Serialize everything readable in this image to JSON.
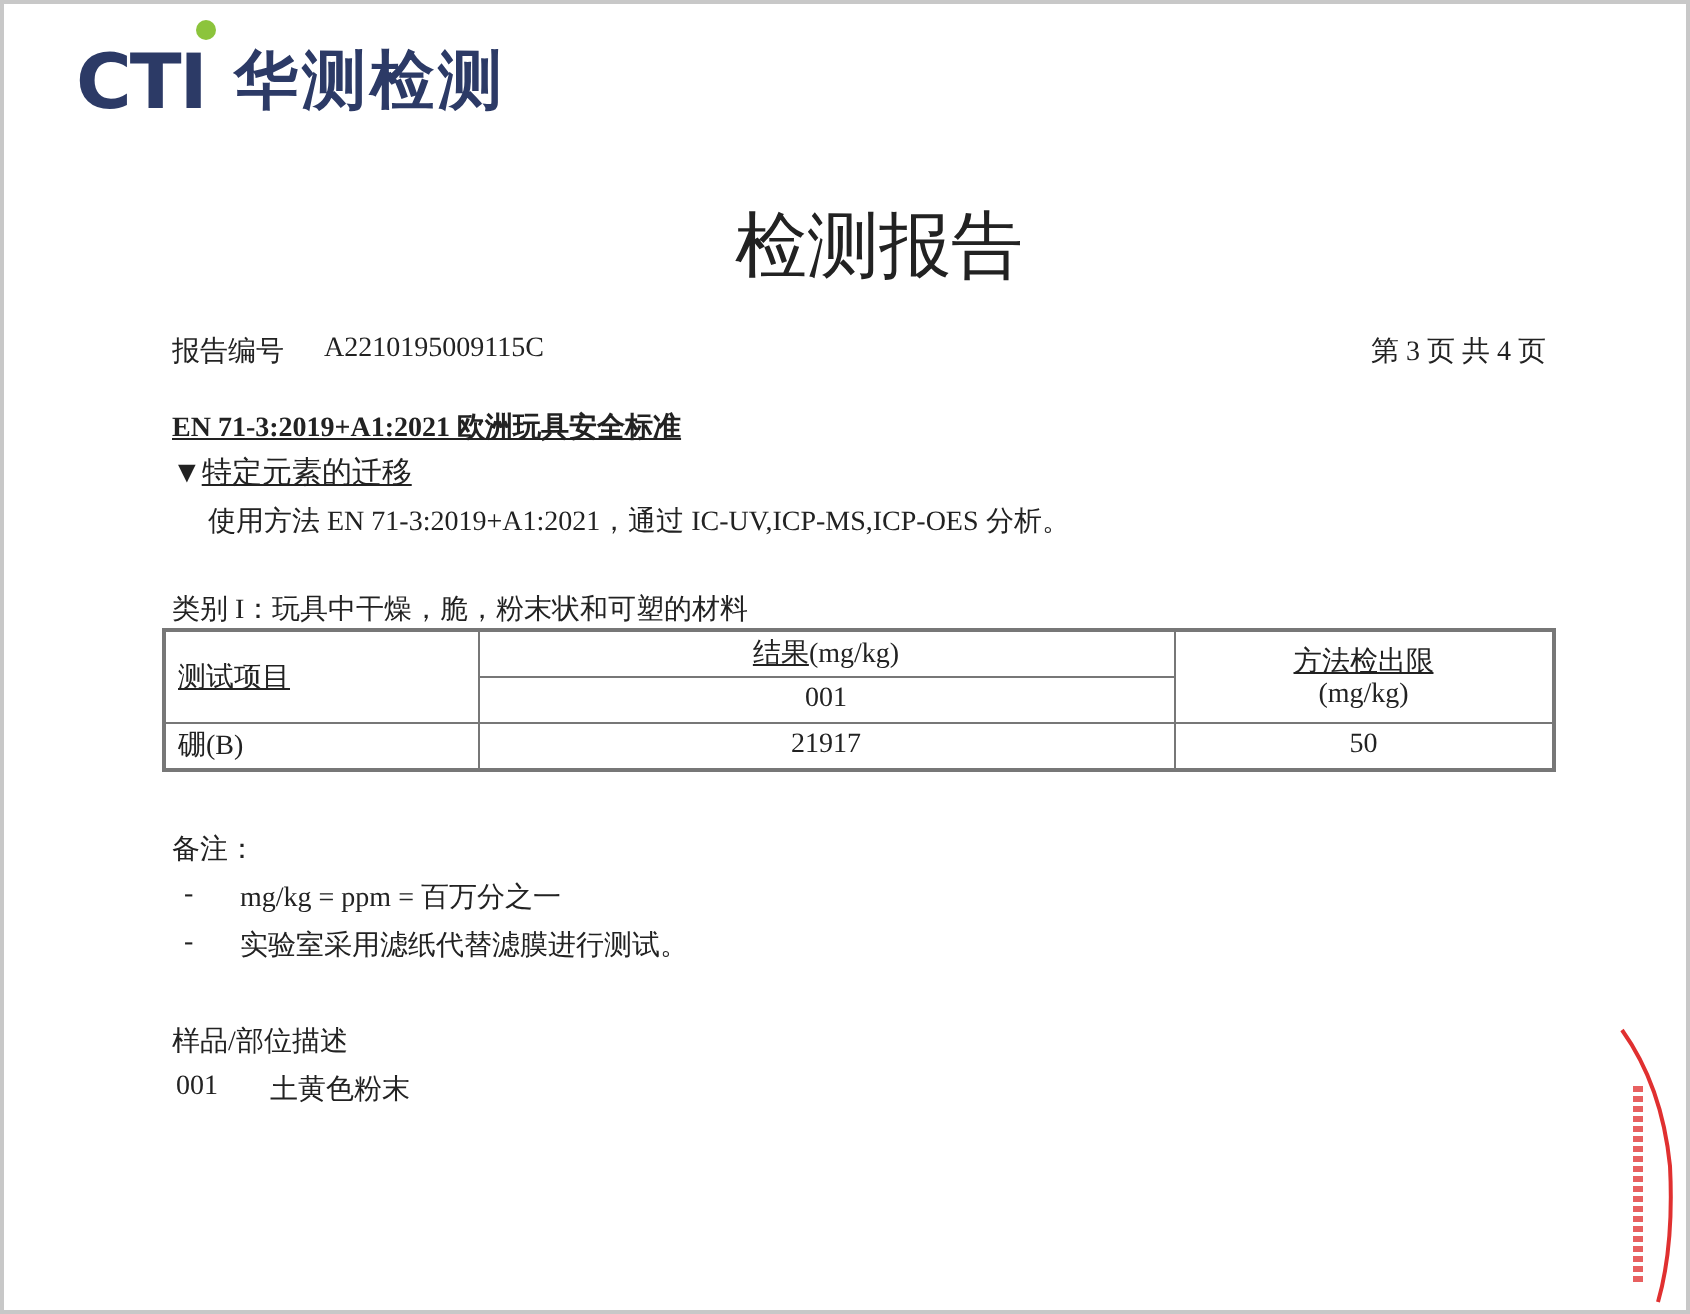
{
  "logo": {
    "brand": "CTI",
    "name": "华测检测"
  },
  "title": "检测报告",
  "report_number": {
    "label": "报告编号",
    "value": "A2210195009115C"
  },
  "page_info": "第 3 页 共 4 页",
  "standard": "EN 71-3:2019+A1:2021  欧洲玩具安全标准",
  "section": {
    "marker": "▼",
    "title": "特定元素的迁移"
  },
  "method": "使用方法 EN 71-3:2019+A1:2021，通过 IC-UV,ICP-MS,ICP-OES 分析。",
  "category": "类别 I：玩具中干燥，脆，粉末状和可塑的材料",
  "table": {
    "columns": [
      {
        "label": "测试项目"
      },
      {
        "label": "结果",
        "unit": "(mg/kg)",
        "sub": "001"
      },
      {
        "label": "方法检出限",
        "unit": "(mg/kg)"
      }
    ],
    "rows": [
      [
        "硼(B)",
        "21917",
        "50"
      ]
    ]
  },
  "notes": {
    "title": "备注：",
    "items": [
      {
        "bullet": "-",
        "text": "mg/kg = ppm =  百万分之一"
      },
      {
        "bullet": "-",
        "text": "实验室采用滤纸代替滤膜进行测试。"
      }
    ]
  },
  "sample": {
    "title": "样品/部位描述",
    "items": [
      {
        "id": "001",
        "description": "土黄色粉末"
      }
    ]
  }
}
